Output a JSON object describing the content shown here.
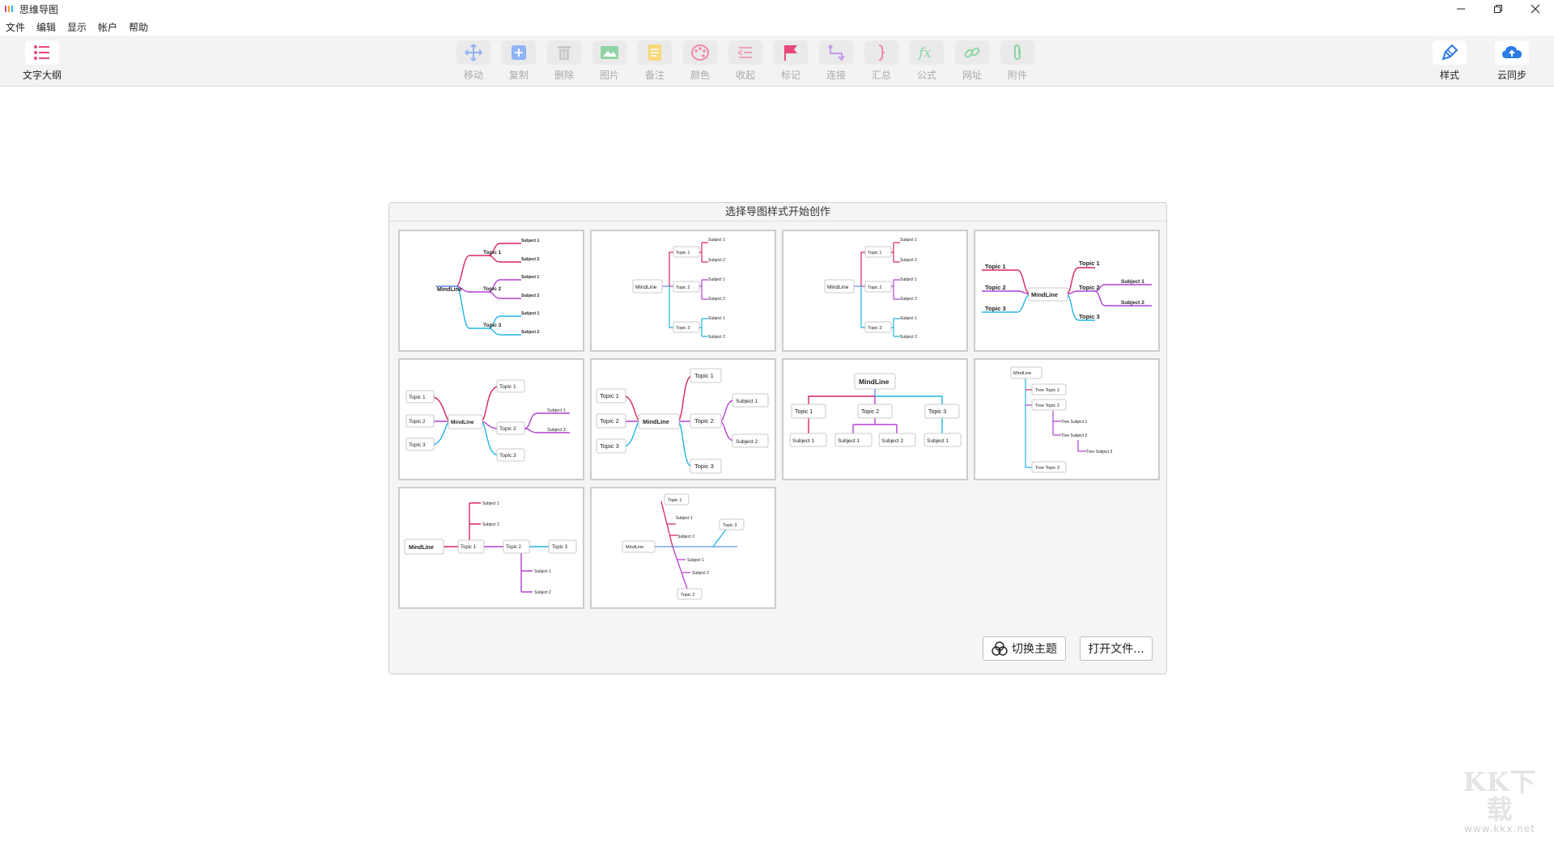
{
  "window": {
    "title": "思维导图"
  },
  "menu": [
    "文件",
    "编辑",
    "显示",
    "帐户",
    "帮助"
  ],
  "toolbar": {
    "outline": "文字大纲",
    "move": "移动",
    "copy": "复制",
    "delete": "删除",
    "image": "图片",
    "note": "备注",
    "color": "颜色",
    "collapse": "收起",
    "mark": "标记",
    "connect": "连接",
    "summary": "汇总",
    "formula": "公式",
    "url": "网址",
    "attachment": "附件",
    "style": "样式",
    "cloud": "云同步"
  },
  "dialog": {
    "title": "选择导图样式开始创作",
    "switch_theme": "切换主题",
    "open_file": "打开文件...",
    "labels": {
      "root": "MindLine",
      "t1": "Topic 1",
      "t2": "Topic 2",
      "t3": "Topic 3",
      "s1": "Subject 1",
      "s2": "Subject 2",
      "s3": "Subject 3",
      "tt1": "Tree Topic 1",
      "tt2": "Tree Topic 2",
      "tt3": "Tree Topic 3",
      "ts1": "Tree Subject 1",
      "ts2": "Tree Subject 2",
      "ts3": "Tree Subject 3"
    }
  },
  "watermark": {
    "big": "KK下载",
    "small": "www.kkx.net"
  },
  "colors": {
    "crimson": "#d6265e",
    "purple": "#b33fd1",
    "cyan": "#1fb5e8",
    "pink": "#e8487a",
    "blue": "#5b8ef0"
  }
}
